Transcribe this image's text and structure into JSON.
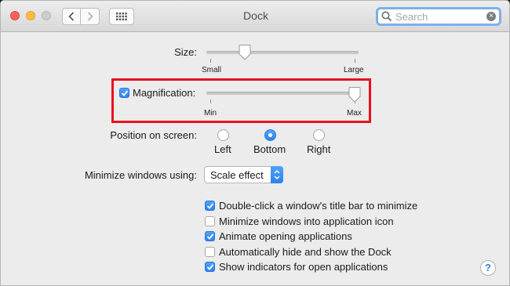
{
  "window": {
    "title": "Dock",
    "search": {
      "placeholder": "Search",
      "value": ""
    }
  },
  "size": {
    "label": "Size:",
    "min_label": "Small",
    "max_label": "Large",
    "level": 0.24
  },
  "magnification": {
    "label": "Magnification:",
    "checked": true,
    "min_label": "Min",
    "max_label": "Max",
    "level": 1.0
  },
  "position": {
    "label": "Position on screen:",
    "options": [
      "Left",
      "Bottom",
      "Right"
    ],
    "selected": "Bottom"
  },
  "minimize": {
    "label": "Minimize windows using:",
    "value": "Scale effect"
  },
  "options": [
    {
      "label": "Double-click a window's title bar to minimize",
      "checked": true
    },
    {
      "label": "Minimize windows into application icon",
      "checked": false
    },
    {
      "label": "Animate opening applications",
      "checked": true
    },
    {
      "label": "Automatically hide and show the Dock",
      "checked": false
    },
    {
      "label": "Show indicators for open applications",
      "checked": true
    }
  ],
  "help_label": "?",
  "colors": {
    "accent": "#3b8ff3",
    "highlight_box": "#e8101c"
  }
}
